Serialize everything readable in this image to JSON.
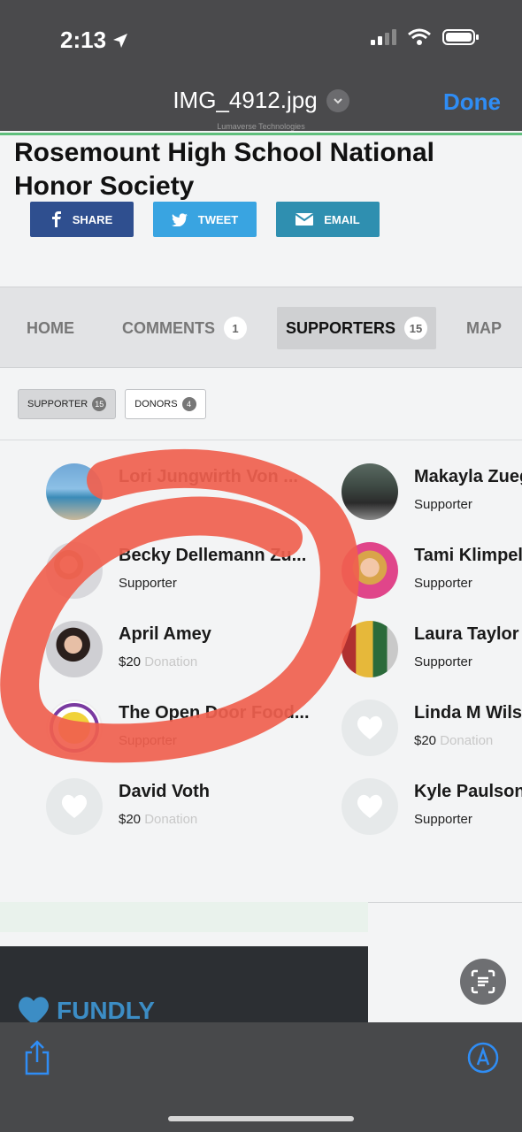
{
  "status_bar": {
    "time": "2:13"
  },
  "viewer": {
    "file_name": "IMG_4912.jpg",
    "done_label": "Done",
    "caption": "Lumaverse Technologies"
  },
  "page": {
    "title": "Rosemount High School National Honor Society",
    "share_buttons": {
      "share": "SHARE",
      "tweet": "TWEET",
      "email": "EMAIL"
    },
    "tabs": [
      {
        "label": "HOME",
        "badge": ""
      },
      {
        "label": "COMMENTS",
        "badge": "1"
      },
      {
        "label": "SUPPORTERS",
        "badge": "15"
      },
      {
        "label": "MAP",
        "badge": ""
      }
    ],
    "filters": [
      {
        "label": "SUPPORTER",
        "count": "15"
      },
      {
        "label": "DONORS",
        "count": "4"
      }
    ],
    "supporters": [
      {
        "name": "Lori Jungwirth Von ...",
        "role": "",
        "amount": "",
        "donation": ""
      },
      {
        "name": "Makayla Zuege",
        "role": "Supporter",
        "amount": "",
        "donation": ""
      },
      {
        "name": "Becky Dellemann Zu...",
        "role": "Supporter",
        "amount": "",
        "donation": ""
      },
      {
        "name": "Tami Klimpel",
        "role": "Supporter",
        "amount": "",
        "donation": ""
      },
      {
        "name": "April Amey",
        "role": "",
        "amount": "$20",
        "donation": "Donation"
      },
      {
        "name": "Laura Taylor K",
        "role": "Supporter",
        "amount": "",
        "donation": ""
      },
      {
        "name": "The Open Door Food...",
        "role": "Supporter",
        "amount": "",
        "donation": ""
      },
      {
        "name": "Linda M Wilson",
        "role": "",
        "amount": "$20",
        "donation": "Donation"
      },
      {
        "name": "David Voth",
        "role": "",
        "amount": "$20",
        "donation": "Donation"
      },
      {
        "name": "Kyle Paulson",
        "role": "Supporter",
        "amount": "",
        "donation": ""
      }
    ],
    "footer_logo": "FUNDLY"
  },
  "colors": {
    "accent": "#2f8df5",
    "scribble": "#f0604e",
    "facebook": "#2f4f8f",
    "twitter": "#39a4e1",
    "email": "#2f8fb0"
  },
  "icons": [
    "location-arrow-icon",
    "signal-icon",
    "wifi-icon",
    "battery-icon",
    "chevron-down-icon",
    "facebook-icon",
    "twitter-icon",
    "email-icon",
    "heart-placeholder-icon",
    "live-text-icon",
    "share-icon",
    "markup-icon"
  ]
}
